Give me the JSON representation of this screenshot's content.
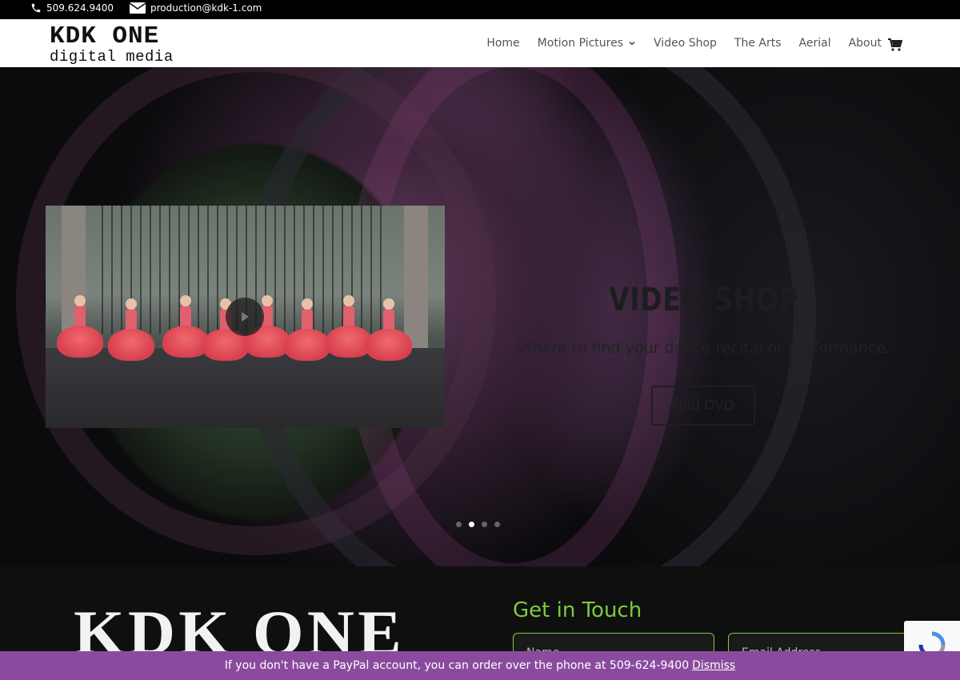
{
  "topbar": {
    "phone": "509.624.9400",
    "email": "production@kdk-1.com"
  },
  "header": {
    "logo_line1": "KDK ONE",
    "logo_line2": "digital media",
    "nav": [
      {
        "label": "Home"
      },
      {
        "label": "Motion Pictures"
      },
      {
        "label": "Video Shop"
      },
      {
        "label": "The Arts"
      },
      {
        "label": "Aerial"
      },
      {
        "label": "About"
      }
    ]
  },
  "hero": {
    "title": "VIDEO SHOP",
    "subtitle": "Where to find your dance recital or performance.",
    "button": "Find DVD",
    "slides_total": 4,
    "active_slide": 2
  },
  "footer": {
    "logo": "KDK ONE",
    "get_in_touch": "Get in Touch",
    "name_placeholder": "Name",
    "email_placeholder": "Email Address"
  },
  "notice": {
    "text": "If you don't have a PayPal account, you can order over the phone at 509-624-9400",
    "dismiss": "Dismiss"
  },
  "colors": {
    "accent_green": "#7ccc3e",
    "notice_purple": "#8a4b9e"
  }
}
